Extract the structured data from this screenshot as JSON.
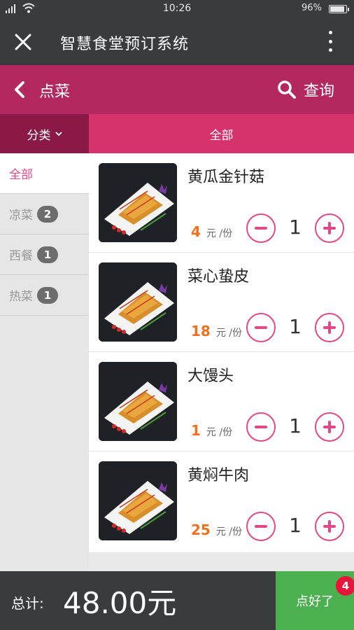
{
  "status_bar": {
    "time": "10:26",
    "battery": "96%"
  },
  "app_bar": {
    "title": "智慧食堂预订系统"
  },
  "page_header": {
    "title": "点菜",
    "query_label": "查询"
  },
  "filter": {
    "category_label": "分类",
    "current": "全部"
  },
  "categories": [
    {
      "label": "全部",
      "badge": ""
    },
    {
      "label": "凉菜",
      "badge": "2"
    },
    {
      "label": "西餐",
      "badge": "1"
    },
    {
      "label": "热菜",
      "badge": "1"
    }
  ],
  "dishes": [
    {
      "name": "黄瓜金针菇",
      "price": "4",
      "unit": "元 /份",
      "qty": "1"
    },
    {
      "name": "菜心蛰皮",
      "price": "18",
      "unit": "元 /份",
      "qty": "1"
    },
    {
      "name": "大馒头",
      "price": "1",
      "unit": "元 /份",
      "qty": "1"
    },
    {
      "name": "黄焖牛肉",
      "price": "25",
      "unit": "元 /份",
      "qty": "1"
    }
  ],
  "footer": {
    "total_label": "总计:",
    "total": "48.00元",
    "confirm": "点好了",
    "cart_count": "4"
  },
  "colors": {
    "accent": "#b3295f",
    "tab_active": "#d6336c",
    "price": "#f07020",
    "confirm": "#4caf50"
  }
}
